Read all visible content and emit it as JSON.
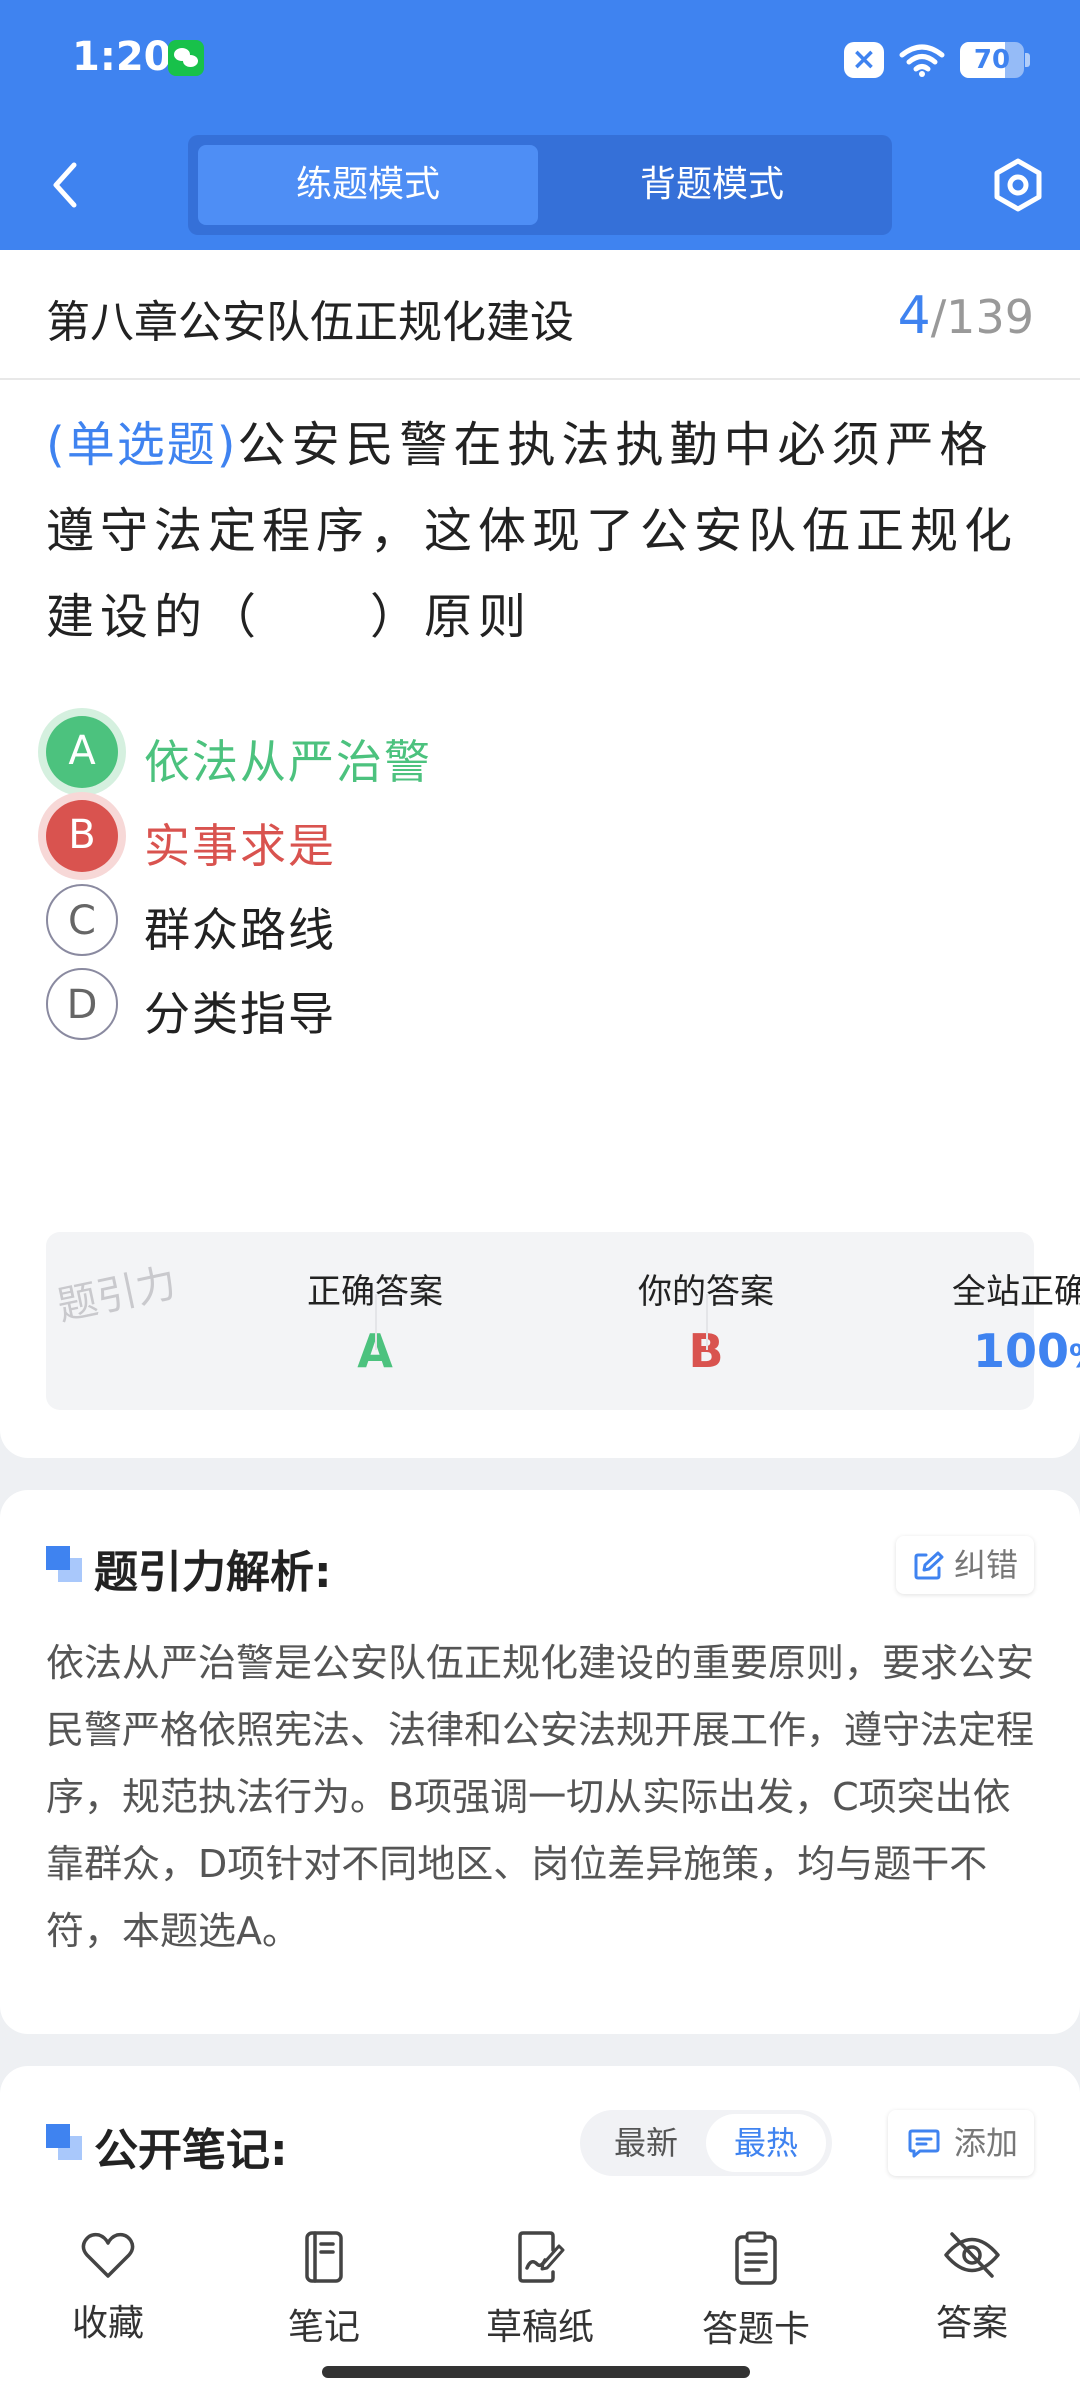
{
  "status_bar": {
    "time": "1:20",
    "battery": "70",
    "battery_level": 0.7
  },
  "header": {
    "back_icon": "chevron-left-icon",
    "modes": [
      "练题模式",
      "背题模式"
    ],
    "active_mode": "练题模式",
    "settings_icon": "settings-hexagon-icon"
  },
  "chapter": {
    "title": "第八章公安队伍正规化建设",
    "current": "4",
    "total": "/139"
  },
  "question": {
    "type": "(单选题)",
    "text": "公安民警在执法执勤中必须严格遵守法定程序，这体现了公安队伍正规化建设的（　　）原则",
    "options": [
      {
        "letter": "A",
        "text": "依法从严治警",
        "state": "correct"
      },
      {
        "letter": "B",
        "text": "实事求是",
        "state": "wrong"
      },
      {
        "letter": "C",
        "text": "群众路线",
        "state": "normal"
      },
      {
        "letter": "D",
        "text": "分类指导",
        "state": "normal"
      }
    ]
  },
  "answer_stats": {
    "correct_label": "正确答案",
    "correct_value": "A",
    "yours_label": "你的答案",
    "yours_value": "B",
    "rate_label": "全站正确率",
    "rate_value": "100",
    "rate_unit": "%",
    "watermark": "题引力"
  },
  "analysis": {
    "title": "题引力解析:",
    "report_label": "纠错",
    "body": "依法从严治警是公安队伍正规化建设的重要原则，要求公安民警严格依照宪法、法律和公安法规开展工作，遵守法定程序，规范执法行为。B项强调一切从实际出发，C项突出依靠群众，D项针对不同地区、岗位差异施策，均与题干不符，本题选A。"
  },
  "notes": {
    "title": "公开笔记:",
    "sort_new": "最新",
    "sort_hot": "最热",
    "active_sort": "最热",
    "add_label": "添加"
  },
  "tabbar": [
    {
      "label": "收藏",
      "icon": "heart-icon"
    },
    {
      "label": "笔记",
      "icon": "notebook-icon"
    },
    {
      "label": "草稿纸",
      "icon": "draft-paper-icon"
    },
    {
      "label": "答题卡",
      "icon": "answer-card-icon"
    },
    {
      "label": "答案",
      "icon": "eye-off-icon"
    }
  ],
  "colors": {
    "accent": "#3f83f0",
    "correct": "#4cc27e",
    "wrong": "#d9534f"
  }
}
